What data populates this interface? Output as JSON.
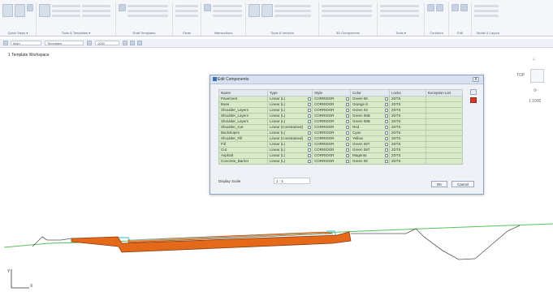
{
  "ribbon": {
    "groups": [
      {
        "label": "Quick Steps ▾"
      },
      {
        "label": "Tools & Templates ▾"
      },
      {
        "label": "Draft Templates"
      },
      {
        "label": "Clean"
      },
      {
        "label": "Intersections"
      },
      {
        "label": "Tools & Vertices"
      },
      {
        "label": "3D Components"
      },
      {
        "label": "Tools ▾"
      },
      {
        "label": "Corridors"
      },
      {
        "label": "Edit"
      },
      {
        "label": "Model & Layout"
      }
    ]
  },
  "toolbar": {
    "field1": "Main",
    "field2": "Templates",
    "field3": "1000"
  },
  "view": {
    "title": "1 Template Workspace"
  },
  "dialog": {
    "title": "Edit Components",
    "close": "X",
    "columns": [
      "Name",
      "Type",
      "Style",
      "Color",
      "Locks",
      "Exception List"
    ],
    "rows": [
      {
        "name": "Pavement",
        "type": "Linear (L)",
        "style": "CORRIDOR",
        "color": "Green 08",
        "locks": "2DTS"
      },
      {
        "name": "Base",
        "type": "Linear (L)",
        "style": "CORRIDOR",
        "color": "Orange 8",
        "locks": "2DTS"
      },
      {
        "name": "Shoulder_Layers",
        "type": "Linear (L)",
        "style": "CORRIDOR",
        "color": "Green 03",
        "locks": "2DTS"
      },
      {
        "name": "Shoulder_Layers",
        "type": "Linear (L)",
        "style": "CORRIDOR",
        "color": "Green 08B",
        "locks": "2DTS"
      },
      {
        "name": "Shoulder_Layers",
        "type": "Linear (L)",
        "style": "CORRIDOR",
        "color": "Green 08B",
        "locks": "2DTS"
      },
      {
        "name": "Shoulder_Cut",
        "type": "Linear (Constrained)",
        "style": "CORRIDOR",
        "color": "Red",
        "locks": "2DTS"
      },
      {
        "name": "Backslopes",
        "type": "Linear (L)",
        "style": "CORRIDOR",
        "color": "Cyan",
        "locks": "2DTS"
      },
      {
        "name": "Shoulder_Fill",
        "type": "Linear (Constrained)",
        "style": "CORRIDOR",
        "color": "Yellow",
        "locks": "2DTS"
      },
      {
        "name": "Fill",
        "type": "Linear (L)",
        "style": "CORRIDOR",
        "color": "Green 08T",
        "locks": "2DTS"
      },
      {
        "name": "Cut",
        "type": "Linear (L)",
        "style": "CORRIDOR",
        "color": "Green 08T",
        "locks": "2DTS"
      },
      {
        "name": "Asphalt",
        "type": "Linear (L)",
        "style": "CORRIDOR",
        "color": "Magenta",
        "locks": "2DTS"
      },
      {
        "name": "Concrete_Barrier",
        "type": "Linear (L)",
        "style": "CORRIDOR",
        "color": "Green 08",
        "locks": "2DTS"
      }
    ],
    "label_display_scale": "Display Scale",
    "scale_value": "1 : 1",
    "ok": "OK",
    "cancel": "Cancel"
  },
  "view_controls": {
    "top_label": "TOP",
    "scale_label": "1:1000"
  },
  "axes": {
    "y": "Y",
    "x": "X"
  },
  "colors": {
    "ribbon_bg": "#f4f6f9",
    "grid_row": "#d7ecc6",
    "section_orange": "#e46a1a",
    "section_brown": "#8a3b12",
    "section_cyan": "#6fd3d9",
    "ground_line": "#57c257",
    "delete_button": "#cc3b2f"
  }
}
